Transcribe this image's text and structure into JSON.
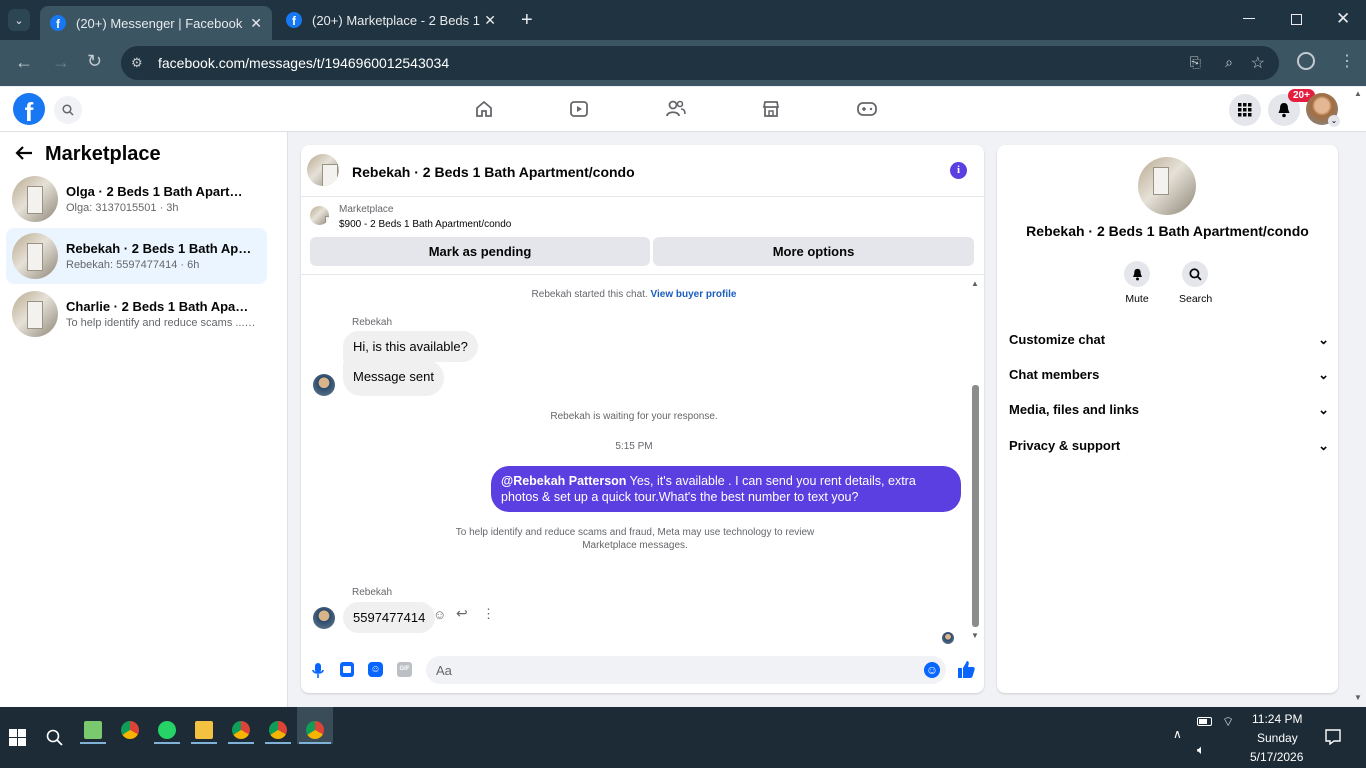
{
  "browser": {
    "tabs": [
      {
        "title": "(20+) Messenger | Facebook",
        "active": true
      },
      {
        "title": "(20+) Marketplace - 2 Beds 1 Ba",
        "active": false
      }
    ],
    "url": "facebook.com/messages/t/1946960012543034"
  },
  "fb_header": {
    "notification_badge": "20+"
  },
  "left_panel": {
    "title": "Marketplace",
    "conversations": [
      {
        "title": "Olga · 2 Beds 1 Bath Apartment...",
        "subtitle": "Olga: 3137015501 · 3h",
        "selected": false
      },
      {
        "title": "Rebekah · 2 Beds 1 Bath Apartm...",
        "subtitle": "Rebekah: 5597477414 · 6h",
        "selected": true
      },
      {
        "title": "Charlie · 2 Beds 1 Bath Apartme...",
        "subtitle": "To help identify and reduce scams ... · 8h",
        "selected": false
      }
    ]
  },
  "chat": {
    "title": "Rebekah · 2 Beds 1 Bath Apartment/condo",
    "listing_source": "Marketplace",
    "listing_summary": "$900 - 2 Beds 1 Bath Apartment/condo",
    "mark_pending_label": "Mark as pending",
    "more_options_label": "More options",
    "started_text": "Rebekah started this chat.",
    "view_profile_link": "View buyer profile",
    "sender_name": "Rebekah",
    "msg1": "Hi, is this available?",
    "msg2": "Message sent",
    "waiting_text": "Rebekah is waiting for your response.",
    "time": "5:15 PM",
    "reply_mention": "@Rebekah Patterson",
    "reply_text": " Yes, it's available .  I can send you rent details, extra photos & set up a quick tour.What's the best number to text you?",
    "notice": "To help identify and reduce scams and fraud, Meta may use technology to review Marketplace messages.",
    "sender_name2": "Rebekah",
    "msg3": "5597477414",
    "composer_placeholder": "Aa",
    "accent_color": "#5b3fe0"
  },
  "right_panel": {
    "title": "Rebekah · 2 Beds 1 Bath Apartment/condo",
    "actions": [
      {
        "label": "Mute",
        "icon": "bell-icon"
      },
      {
        "label": "Search",
        "icon": "search-icon"
      }
    ],
    "sections": [
      "Customize chat",
      "Chat members",
      "Media, files and links",
      "Privacy & support"
    ]
  },
  "taskbar": {
    "time": "11:24 PM",
    "day": "Sunday",
    "date": "5/17/2026"
  }
}
